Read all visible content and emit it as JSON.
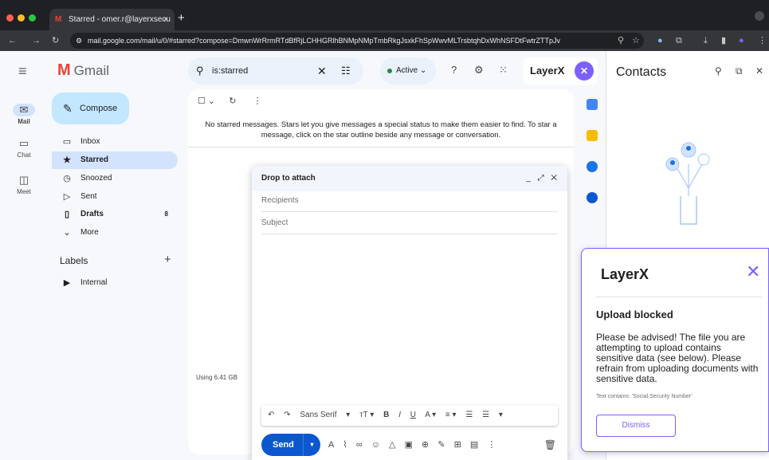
{
  "browser": {
    "tab_title": "Starred - omer.r@layerxsecu",
    "tab_close": "×",
    "new_tab": "+",
    "url": "mail.google.com/mail/u/0/#starred?compose=DmwnWrRrmRTdBfRjLCHHGRlhBNMpNMpTmbRkgJsxkFhSpWwvMLTrsbtqhDxWhNSFDtFwtrZTTpJv"
  },
  "gmail": {
    "app_name": "Gmail",
    "compose_label": "Compose",
    "rail": [
      {
        "label": "Mail",
        "icon": "mail-icon"
      },
      {
        "label": "Chat",
        "icon": "chat-icon"
      },
      {
        "label": "Meet",
        "icon": "meet-icon"
      }
    ],
    "nav": [
      {
        "label": "Inbox",
        "icon": "inbox-icon",
        "count": ""
      },
      {
        "label": "Starred",
        "icon": "star-icon",
        "count": ""
      },
      {
        "label": "Snoozed",
        "icon": "clock-icon",
        "count": ""
      },
      {
        "label": "Sent",
        "icon": "send-icon",
        "count": ""
      },
      {
        "label": "Drafts",
        "icon": "draft-icon",
        "count": "8"
      },
      {
        "label": "More",
        "icon": "chevron-down-icon",
        "count": ""
      }
    ],
    "labels_heading": "Labels",
    "labels_add": "+",
    "labels": [
      {
        "label": "Internal",
        "icon": "label-icon"
      }
    ],
    "search_value": "is:starred",
    "status_label": "Active",
    "empty_message": "No starred messages. Stars let you give messages a special status to make them easier to find. To star a message, click on the star outline beside any message or conversation.",
    "storage": "Using 6.41 GB",
    "layerx_badge": "LayerX"
  },
  "composer": {
    "title": "Drop to attach",
    "recipients_placeholder": "Recipients",
    "subject_placeholder": "Subject",
    "font_name": "Sans Serif",
    "send_label": "Send"
  },
  "contacts": {
    "title": "Contacts"
  },
  "popup": {
    "logo": "LayerX",
    "title": "Upload blocked",
    "body": "Please be advised! The file you are attempting to upload contains sensitive data (see below). Please refrain from uploading documents with sensitive data.",
    "detail": "Text contains: 'Social Security Number'",
    "dismiss_label": "Dismiss",
    "accent": "#7b61ff"
  }
}
